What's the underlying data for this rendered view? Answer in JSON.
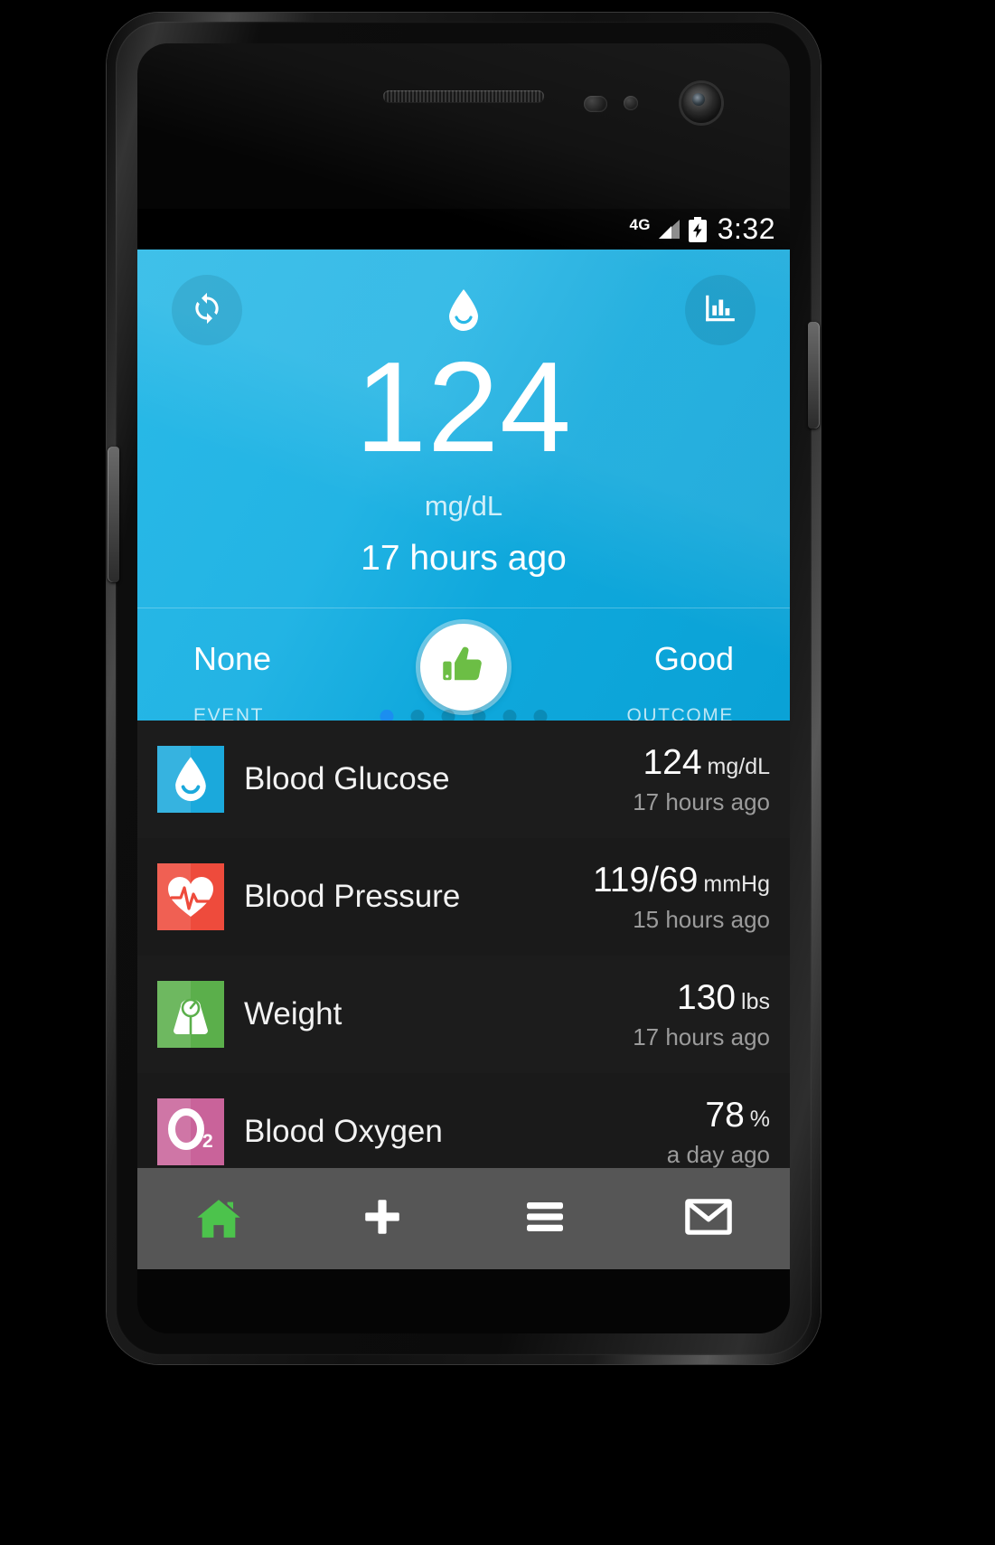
{
  "statusbar": {
    "network": "4G",
    "time": "3:32",
    "signal_icon": "signal-bars-icon",
    "battery_icon": "battery-charging-icon"
  },
  "hero": {
    "refresh_icon": "refresh-icon",
    "chart_icon": "bar-chart-icon",
    "metric_icon": "water-drop-smiley-icon",
    "value": "124",
    "unit": "mg/dL",
    "time_ago": "17 hours ago",
    "event_value": "None",
    "outcome_value": "Good",
    "event_caption": "EVENT",
    "outcome_caption": "OUTCOME",
    "badge_icon": "thumbs-up-icon",
    "pager": {
      "total": 6,
      "active_index": 0
    },
    "accent_color": "#1FB3E0",
    "dot_active_color": "#1B8EF0",
    "badge_icon_color": "#6CBE45"
  },
  "list": {
    "rows": [
      {
        "label": "Blood Glucose",
        "value": "124",
        "unit": "mg/dL",
        "time_ago": "17 hours ago",
        "icon": "water-drop-smiley-icon",
        "icon_color": "#1BA9DC"
      },
      {
        "label": "Blood Pressure",
        "value": "119/69",
        "unit": "mmHg",
        "time_ago": "15 hours ago",
        "icon": "heart-pulse-icon",
        "icon_color": "#EE4B3C"
      },
      {
        "label": "Weight",
        "value": "130",
        "unit": "lbs",
        "time_ago": "17 hours ago",
        "icon": "weight-scale-icon",
        "icon_color": "#5BAF4B"
      },
      {
        "label": "Blood Oxygen",
        "value": "78",
        "unit": "%",
        "time_ago": "a day ago",
        "icon": "o2-icon",
        "icon_color": "#C9639A"
      }
    ]
  },
  "navbar": {
    "items": [
      {
        "icon": "home-icon",
        "color": "#4CC34C"
      },
      {
        "icon": "plus-icon",
        "color": "#FFFFFF"
      },
      {
        "icon": "hamburger-menu-icon",
        "color": "#FFFFFF"
      },
      {
        "icon": "envelope-icon",
        "color": "#FFFFFF"
      }
    ]
  }
}
